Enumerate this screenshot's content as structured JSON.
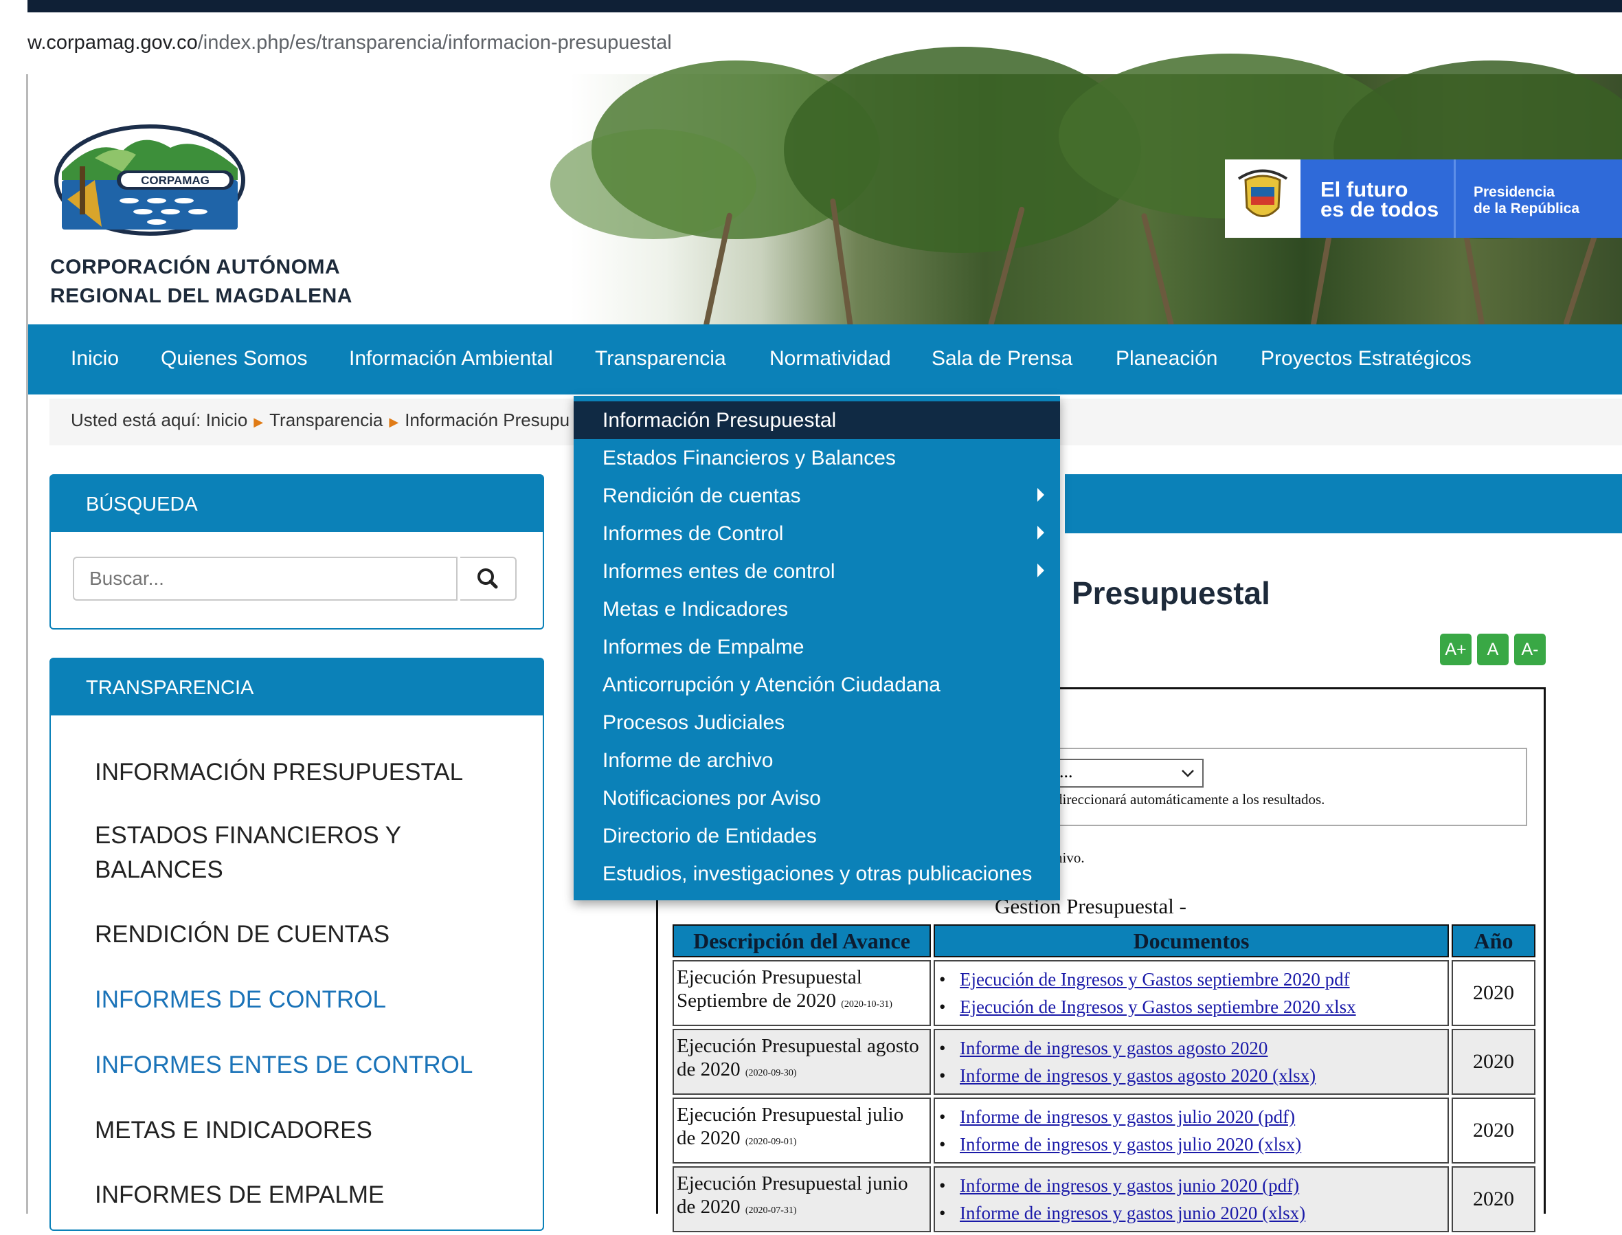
{
  "browser": {
    "url_domain": "w.corpamag.gov.co",
    "url_path": "/index.php/es/transparencia/informacion-presupuestal"
  },
  "header": {
    "logo_text": "CORPAMAG",
    "org_line1": "CORPORACIÓN AUTÓNOMA",
    "org_line2": "REGIONAL DEL MAGDALENA",
    "gov_slogan_line1": "El futuro",
    "gov_slogan_line2": "es de todos",
    "gov_entity_line1": "Presidencia",
    "gov_entity_line2": "de la República"
  },
  "nav": [
    "Inicio",
    "Quienes Somos",
    "Información Ambiental",
    "Transparencia",
    "Normatividad",
    "Sala de Prensa",
    "Planeación",
    "Proyectos Estratégicos"
  ],
  "breadcrumb": {
    "prefix": "Usted está aquí:",
    "items": [
      "Inicio",
      "Transparencia",
      "Información Presupu"
    ]
  },
  "search": {
    "title": "BÚSQUEDA",
    "placeholder": "Buscar..."
  },
  "transparency": {
    "title": "TRANSPARENCIA",
    "links": [
      "INFORMACIÓN PRESUPUESTAL",
      "ESTADOS FINANCIEROS Y BALANCES",
      "RENDICIÓN DE CUENTAS",
      "INFORMES DE CONTROL",
      "INFORMES ENTES DE CONTROL",
      "METAS E INDICADORES",
      "INFORMES DE EMPALME"
    ]
  },
  "dropdown": [
    {
      "label": "Información Presupuestal",
      "active": true
    },
    {
      "label": "Estados Financieros y Balances"
    },
    {
      "label": "Rendición de cuentas",
      "submenu": true
    },
    {
      "label": "Informes de Control",
      "submenu": true
    },
    {
      "label": "Informes entes de control",
      "submenu": true
    },
    {
      "label": "Metas e Indicadores"
    },
    {
      "label": "Informes de Empalme"
    },
    {
      "label": "Anticorrupción y Atención Ciudadana"
    },
    {
      "label": "Procesos Judiciales"
    },
    {
      "label": "Informe de archivo"
    },
    {
      "label": "Notificaciones por Aviso"
    },
    {
      "label": "Directorio de Entidades"
    },
    {
      "label": "Estudios, investigaciones y otras publicaciones"
    }
  ],
  "content": {
    "title_visible": "Presupuestal",
    "size_buttons": [
      "A+",
      "A",
      "A-"
    ],
    "select_value": "...",
    "select_note": "direccionará automáticamente a los resultados.",
    "archive_note": "hivo.",
    "table_caption": "Gestion Presupuestal -",
    "headers": [
      "Descripción del Avance",
      "Documentos",
      "Año"
    ],
    "rows": [
      {
        "desc": "Ejecución Presupuestal Septiembre de 2020",
        "date": "(2020-10-31)",
        "docs": [
          "Ejecución de Ingresos y Gastos septiembre 2020 pdf",
          "Ejecución de Ingresos y Gastos septiembre 2020 xlsx"
        ],
        "year": "2020"
      },
      {
        "desc": "Ejecución Presupuestal agosto de 2020",
        "date": "(2020-09-30)",
        "docs": [
          "Informe de ingresos y gastos agosto 2020",
          "Informe de ingresos y gastos agosto 2020 (xlsx)"
        ],
        "year": "2020"
      },
      {
        "desc": "Ejecución Presupuestal julio de 2020",
        "date": "(2020-09-01)",
        "docs": [
          "Informe de ingresos y gastos julio 2020 (pdf)",
          "Informe de ingresos y gastos julio 2020 (xlsx)"
        ],
        "year": "2020"
      },
      {
        "desc": "Ejecución Presupuestal junio de 2020",
        "date": "(2020-07-31)",
        "docs": [
          "Informe de ingresos y gastos junio 2020 (pdf)",
          "Informe de ingresos y gastos junio 2020 (xlsx)"
        ],
        "year": "2020"
      }
    ]
  },
  "colors": {
    "brand_blue": "#0b81b8",
    "active_menu": "#102a44",
    "gov_blue": "#2f6ad9",
    "size_btn_green": "#39a845"
  }
}
